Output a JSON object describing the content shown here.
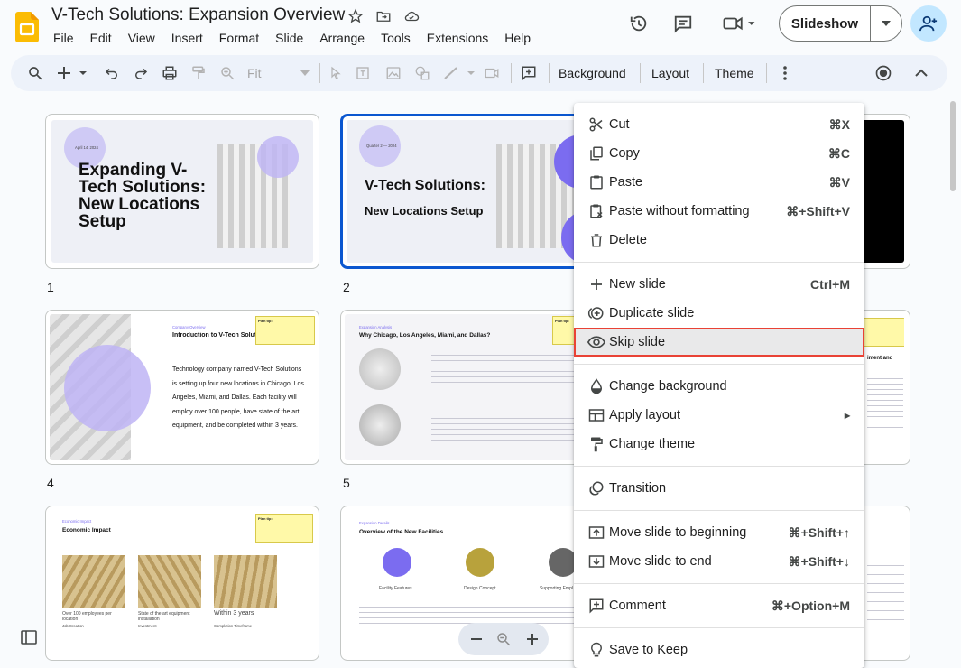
{
  "header": {
    "title": "V-Tech Solutions: Expansion Overview",
    "menu": [
      "File",
      "Edit",
      "View",
      "Insert",
      "Format",
      "Slide",
      "Arrange",
      "Tools",
      "Extensions",
      "Help"
    ],
    "slideshow_label": "Slideshow"
  },
  "toolbar": {
    "zoom_label": "Fit",
    "background": "Background",
    "layout": "Layout",
    "theme": "Theme"
  },
  "slides": {
    "s1": {
      "num": "1",
      "date": "April 14, 2024",
      "title": "Expanding V-Tech Solutions: New Locations Setup"
    },
    "s2": {
      "num": "2",
      "date": "Quarter 2 — 2024",
      "title": "V-Tech Solutions:",
      "subtitle": "New Locations Setup"
    },
    "s4": {
      "num": "4",
      "eyebrow": "Company Overview",
      "title": "Introduction to V-Tech Solutions",
      "body": "Technology company named V-Tech Solutions is setting up four new locations in Chicago, Los Angeles, Miami, and Dallas. Each facility will employ over 100 people, have state of the art equipment, and be completed within 3 years.",
      "tip": "Plan tip:"
    },
    "s5": {
      "num": "5",
      "eyebrow": "Expansion Analysis",
      "title": "Why Chicago, Los Angeles, Miami, and Dallas?",
      "tip": "Plan tip:"
    },
    "s7": {
      "num": "",
      "eyebrow": "Economic Impact",
      "title": "Economic Impact",
      "tip": "Plan tip:",
      "items": [
        {
          "label": "Over 100 employees per location",
          "sub": "Job Creation"
        },
        {
          "label": "State of the art equipment installation",
          "sub": "Investment"
        },
        {
          "label": "Within 3 years",
          "sub": "Completion Timeframe"
        }
      ]
    },
    "s8": {
      "num": "",
      "eyebrow": "Expansion Details",
      "title": "Overview of the New Facilities",
      "cols": [
        "Facility Features",
        "Design Concept",
        "Supporting Empl"
      ]
    },
    "s6": {
      "right_title": "iment and"
    }
  },
  "context_menu": {
    "items": [
      {
        "icon": "cut-icon",
        "label": "Cut",
        "shortcut": "⌘X"
      },
      {
        "icon": "copy-icon",
        "label": "Copy",
        "shortcut": "⌘C"
      },
      {
        "icon": "paste-icon",
        "label": "Paste",
        "shortcut": "⌘V"
      },
      {
        "icon": "paste-plain-icon",
        "label": "Paste without formatting",
        "shortcut": "⌘+Shift+V"
      },
      {
        "icon": "trash-icon",
        "label": "Delete",
        "shortcut": ""
      },
      {
        "icon": "plus-icon",
        "label": "New slide",
        "shortcut": "Ctrl+M"
      },
      {
        "icon": "duplicate-icon",
        "label": "Duplicate slide",
        "shortcut": ""
      },
      {
        "icon": "eye-icon",
        "label": "Skip slide",
        "shortcut": ""
      },
      {
        "icon": "paint-drop-icon",
        "label": "Change background",
        "shortcut": ""
      },
      {
        "icon": "layout-icon",
        "label": "Apply layout",
        "shortcut": "▸"
      },
      {
        "icon": "paint-roller-icon",
        "label": "Change theme",
        "shortcut": ""
      },
      {
        "icon": "transition-icon",
        "label": "Transition",
        "shortcut": ""
      },
      {
        "icon": "move-up-icon",
        "label": "Move slide to beginning",
        "shortcut": "⌘+Shift+↑"
      },
      {
        "icon": "move-down-icon",
        "label": "Move slide to end",
        "shortcut": "⌘+Shift+↓"
      },
      {
        "icon": "comment-icon",
        "label": "Comment",
        "shortcut": "⌘+Option+M"
      },
      {
        "icon": "bulb-icon",
        "label": "Save to Keep",
        "shortcut": ""
      }
    ],
    "highlighted": "Skip slide"
  },
  "colors": {
    "accent": "#0b57d0",
    "highlight_border": "#e94235",
    "purple": "#7b6cf0",
    "lavender": "#cfcaf5"
  }
}
